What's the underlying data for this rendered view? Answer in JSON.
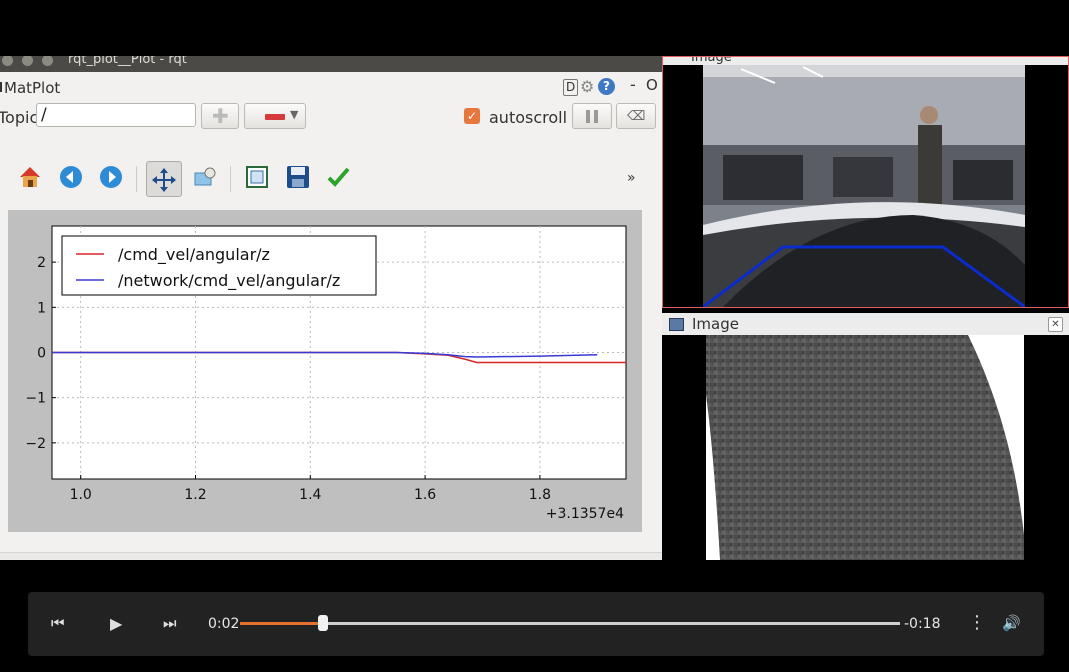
{
  "rqt": {
    "window_title": "rqt_plot__Plot - rqt",
    "plugin_name": "MatPlot",
    "plugin_buttons": {
      "d": "D",
      "min": "-",
      "close": "O"
    },
    "topic_label": "Topic",
    "topic_value": "/",
    "autoscroll_label": "autoscroll",
    "autoscroll_checked": true,
    "more_label": "»",
    "toolbar_icons": [
      "home-icon",
      "back-icon",
      "forward-icon",
      "pan-icon",
      "zoom-icon",
      "subplots-icon",
      "save-icon",
      "edit-curves-icon"
    ]
  },
  "image_windows": [
    {
      "title": "Image"
    },
    {
      "title": "Image"
    }
  ],
  "video": {
    "current_time": "0:02",
    "remaining_time": "-0:18",
    "progress": 0.125
  },
  "colors": {
    "series_red": "#d62728",
    "series_blue": "#3a3ad4",
    "progress_accent": "#e4702d",
    "overlay_blue": "#0a2ccc"
  },
  "chart_data": {
    "type": "line",
    "xlim": [
      0.95,
      1.95
    ],
    "ylim": [
      -2.8,
      2.8
    ],
    "xticks": [
      "1.0",
      "1.2",
      "1.4",
      "1.6",
      "1.8"
    ],
    "xtick_values": [
      1.0,
      1.2,
      1.4,
      1.6,
      1.8
    ],
    "yticks": [
      "2",
      "1",
      "0",
      "−1",
      "−2"
    ],
    "ytick_values": [
      2,
      1,
      0,
      -1,
      -2
    ],
    "x_offset_label": "+3.1357e4",
    "grid": true,
    "legend_position": "top-left",
    "series": [
      {
        "name": "/cmd_vel/angular/z",
        "color": "#d62728",
        "x": [
          0.95,
          1.55,
          1.6,
          1.64,
          1.67,
          1.69,
          1.95
        ],
        "y": [
          0.0,
          0.0,
          -0.03,
          -0.06,
          -0.15,
          -0.22,
          -0.22
        ]
      },
      {
        "name": "/network/cmd_vel/angular/z",
        "color": "#3a3ad4",
        "x": [
          0.95,
          1.55,
          1.6,
          1.64,
          1.67,
          1.69,
          1.8,
          1.9
        ],
        "y": [
          0.0,
          0.0,
          -0.02,
          -0.05,
          -0.09,
          -0.1,
          -0.08,
          -0.05
        ]
      }
    ]
  }
}
